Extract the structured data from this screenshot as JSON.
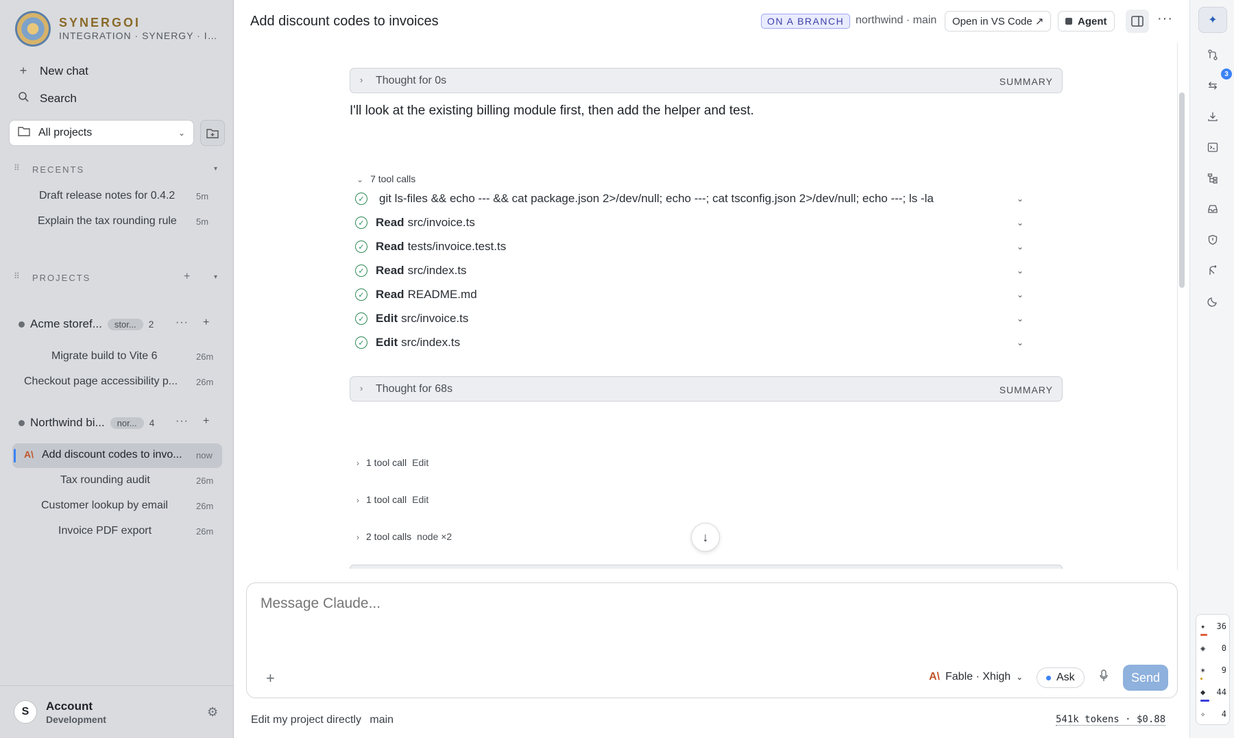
{
  "brand": {
    "title": "SYNERGOI",
    "subtitle": "INTEGRATION · SYNERGY · INNOVATION"
  },
  "sidebar": {
    "new_chat": "New chat",
    "search": "Search",
    "project_filter": "All projects",
    "recents_label": "RECENTS",
    "recents": [
      {
        "title": "Draft release notes for 0.4.2",
        "time": "5m"
      },
      {
        "title": "Explain the tax rounding rule",
        "time": "5m"
      }
    ],
    "projects_label": "PROJECTS",
    "projects": [
      {
        "name": "Acme storef...",
        "tag": "stor...",
        "count": "2",
        "chats": [
          {
            "title": "Migrate build to Vite 6",
            "time": "26m"
          },
          {
            "title": "Checkout page accessibility p...",
            "time": "26m"
          }
        ]
      },
      {
        "name": "Northwind bi...",
        "tag": "nor...",
        "count": "4",
        "chats": [
          {
            "title": "Add discount codes to invo...",
            "time": "now"
          },
          {
            "title": "Tax rounding audit",
            "time": "26m"
          },
          {
            "title": "Customer lookup by email",
            "time": "26m"
          },
          {
            "title": "Invoice PDF export",
            "time": "26m"
          }
        ]
      }
    ],
    "account": {
      "initial": "S",
      "name": "Account",
      "sub": "Development"
    }
  },
  "header": {
    "title": "Add discount codes to invoices",
    "branch_badge": "ON A BRANCH",
    "repo": "northwind · main",
    "open_vscode": "Open in VS Code ↗",
    "agent": "Agent"
  },
  "conversation": {
    "thought1": {
      "label": "Thought for 0s",
      "summary": "SUMMARY"
    },
    "assistant_text": "I'll look at the existing billing module first, then add the helper and test.",
    "tool_group": {
      "label": "7 tool calls",
      "calls": [
        {
          "verb": "",
          "target": "git ls-files && echo --- && cat package.json 2>/dev/null; echo ---; cat tsconfig.json 2>/dev/null; echo ---; ls -la"
        },
        {
          "verb": "Read",
          "target": "src/invoice.ts"
        },
        {
          "verb": "Read",
          "target": "tests/invoice.test.ts"
        },
        {
          "verb": "Read",
          "target": "src/index.ts"
        },
        {
          "verb": "Read",
          "target": "README.md"
        },
        {
          "verb": "Edit",
          "target": "src/invoice.ts"
        },
        {
          "verb": "Edit",
          "target": "src/index.ts"
        }
      ]
    },
    "thought2": {
      "label": "Thought for 68s",
      "summary": "SUMMARY"
    },
    "collapsed_groups": [
      {
        "label": "1 tool call",
        "extra": "Edit"
      },
      {
        "label": "1 tool call",
        "extra": "Edit"
      },
      {
        "label": "2 tool calls",
        "extra": "node ×2"
      }
    ]
  },
  "composer": {
    "placeholder": "Message Claude...",
    "model": "Fable · Xhigh",
    "mode": "Ask",
    "send": "Send"
  },
  "footer": {
    "mode": "Edit my project directly",
    "branch": "main",
    "usage": "541k tokens · $0.88"
  },
  "rail": {
    "badge_count": "3",
    "stats": [
      {
        "glyph": "✦",
        "value": "36",
        "color": "#e0603a"
      },
      {
        "glyph": "◈",
        "value": "0",
        "color": ""
      },
      {
        "glyph": "✶",
        "value": "9",
        "color": "#d4a017"
      },
      {
        "glyph": "◆",
        "value": "44",
        "color": "#3b3fd8"
      },
      {
        "glyph": "✧",
        "value": "4",
        "color": "#6a6f75"
      }
    ]
  },
  "colors": {
    "accent": "#3b82f6",
    "success": "#2e8b57",
    "sidebar_bg": "#d9dbde",
    "send_bg": "#8eb1dd",
    "brand_gold": "#8a6a2a"
  }
}
